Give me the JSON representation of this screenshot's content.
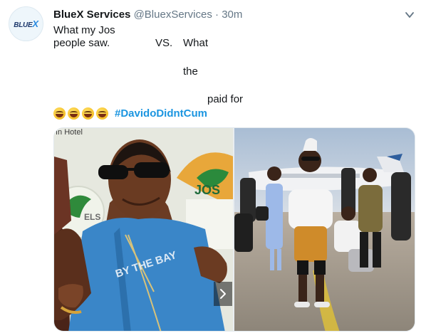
{
  "tweet": {
    "avatar": {
      "logo_text": "BLUE",
      "logo_accent": "X"
    },
    "display_name": "BlueX Services",
    "handle": "@BluexServices",
    "separator": "·",
    "time": "30m",
    "text_lines": [
      "What my Jos",
      "people saw.",
      "VS.",
      "What",
      "the",
      "paid for"
    ],
    "emoji_count": 4,
    "emoji_icon": "rolling-laughing-face-icon",
    "hashtag": "#DavidoDidntCum"
  },
  "media": {
    "left_photo_text": {
      "hotel": "ın Hotel",
      "els": "ELS",
      "jos": "JOS"
    },
    "next_icon": "chevron-right-icon"
  },
  "colors": {
    "link": "#1b95e0",
    "muted": "#657786",
    "text": "#14171a"
  }
}
